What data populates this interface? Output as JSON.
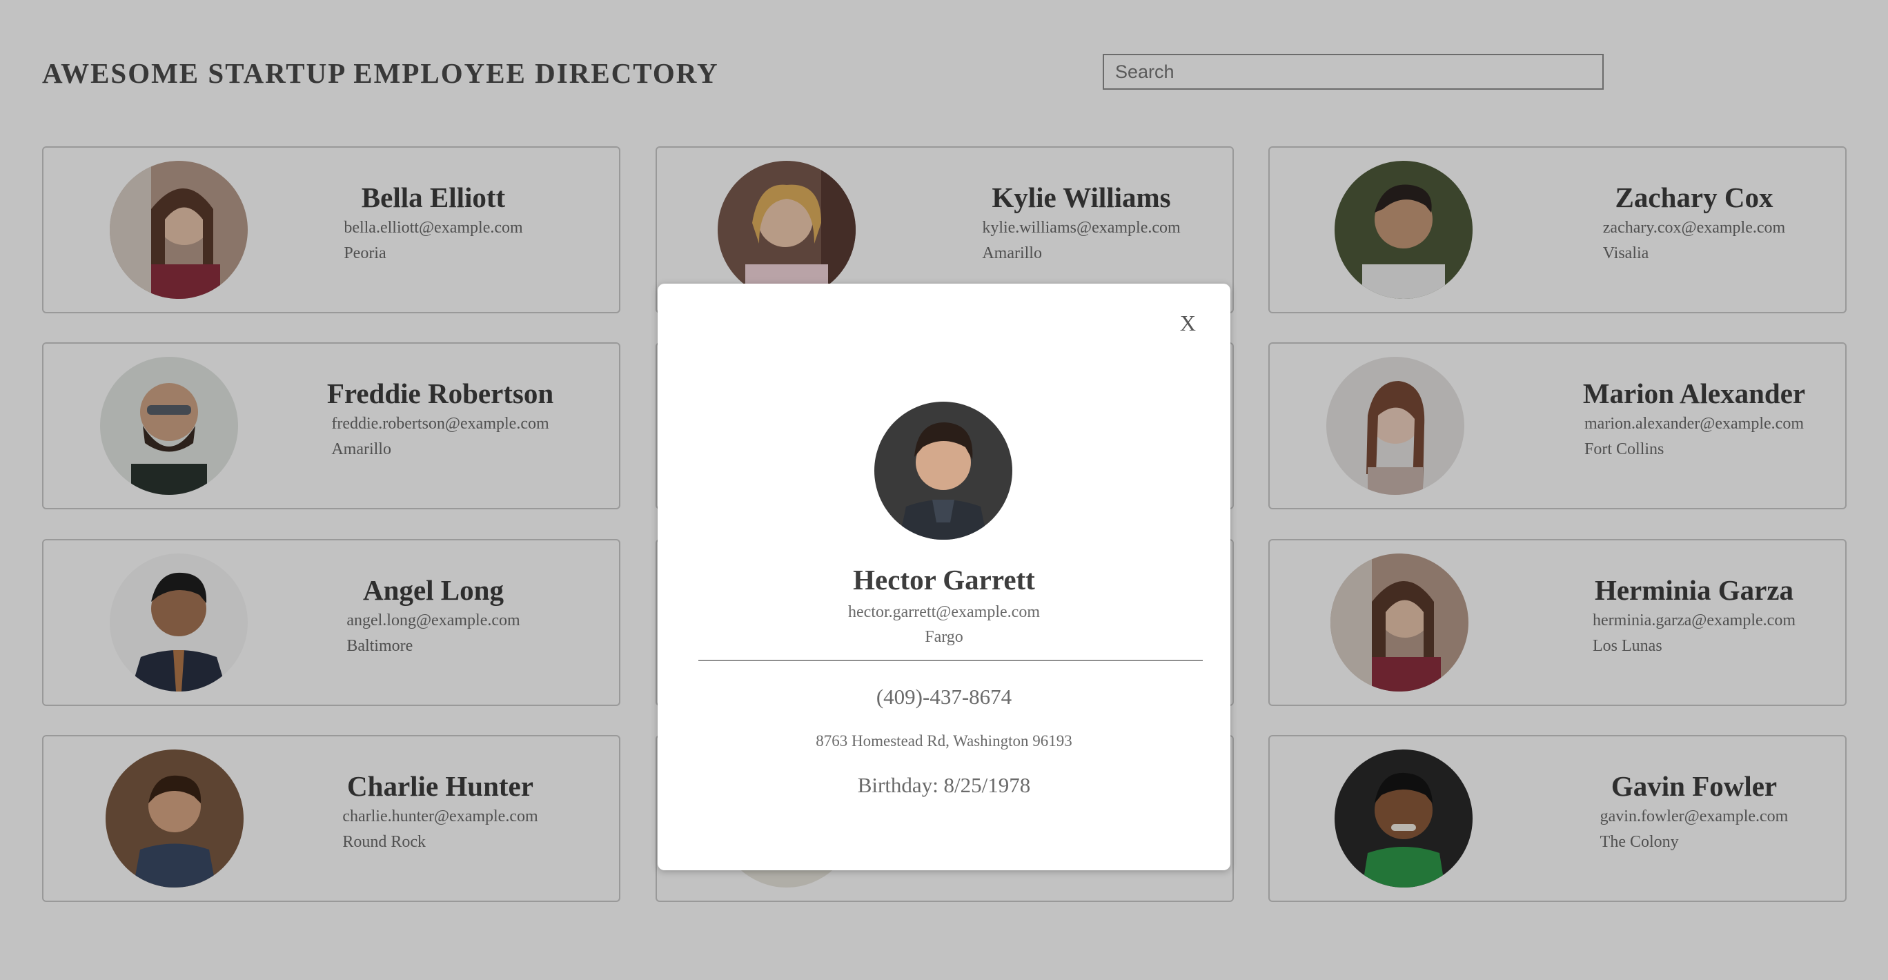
{
  "header": {
    "title": "AWESOME STARTUP EMPLOYEE DIRECTORY",
    "search_placeholder": "Search",
    "search_value": ""
  },
  "employees": [
    {
      "name": "Bella Elliott",
      "email": "bella.elliott@example.com",
      "city": "Peoria"
    },
    {
      "name": "Kylie Williams",
      "email": "kylie.williams@example.com",
      "city": "Amarillo"
    },
    {
      "name": "Zachary Cox",
      "email": "zachary.cox@example.com",
      "city": "Visalia"
    },
    {
      "name": "Freddie Robertson",
      "email": "freddie.robertson@example.com",
      "city": "Amarillo"
    },
    {
      "name": "",
      "email": "",
      "city": ""
    },
    {
      "name": "Marion Alexander",
      "email": "marion.alexander@example.com",
      "city": "Fort Collins"
    },
    {
      "name": "Angel Long",
      "email": "angel.long@example.com",
      "city": "Baltimore"
    },
    {
      "name": "",
      "email": "",
      "city": ""
    },
    {
      "name": "Herminia Garza",
      "email": "herminia.garza@example.com",
      "city": "Los Lunas"
    },
    {
      "name": "Charlie Hunter",
      "email": "charlie.hunter@example.com",
      "city": "Round Rock"
    },
    {
      "name": "",
      "email": "",
      "city": ""
    },
    {
      "name": "Gavin Fowler",
      "email": "gavin.fowler@example.com",
      "city": "The Colony"
    }
  ],
  "modal": {
    "close_label": "X",
    "name": "Hector Garrett",
    "email": "hector.garrett@example.com",
    "city": "Fargo",
    "phone": "(409)-437-8674",
    "address": "8763 Homestead Rd, Washington 96193",
    "birthday": "Birthday: 8/25/1978"
  },
  "colors": {
    "overlay": "rgba(0,0,0,0.24)",
    "card_border": "#c9c9c9",
    "heading_text": "#3d3d3d",
    "secondary_text": "#6a6a6a"
  }
}
